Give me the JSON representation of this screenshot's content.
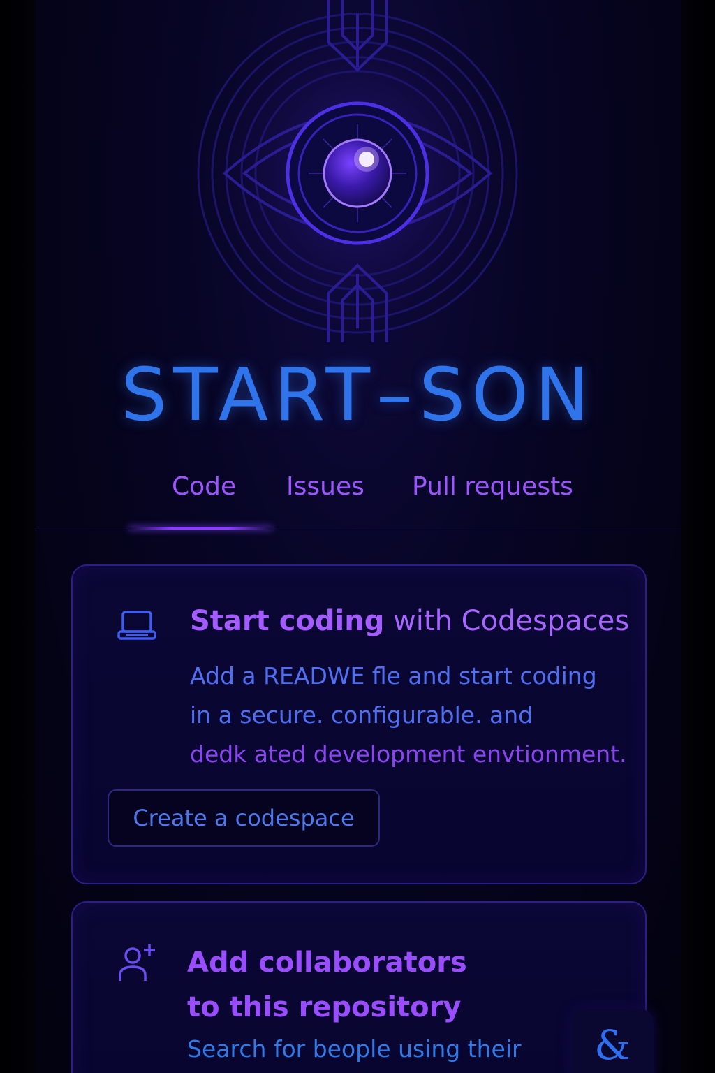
{
  "app": {
    "title": "START–SON"
  },
  "tabs": [
    {
      "label": "Code",
      "active": true
    },
    {
      "label": "Issues",
      "active": false
    },
    {
      "label": "Pull requests",
      "active": false
    }
  ],
  "codespaces_card": {
    "heading_strong": "Start coding",
    "heading_rest": "with Codespaces",
    "description_lines": [
      "Add a READWE fle and start coding",
      "in a secure. configurable. and",
      "dedk ated development envtionment."
    ],
    "button_label": "Create a codespace",
    "icon": "laptop-icon"
  },
  "collaborators_card": {
    "heading_lines": [
      "Add collaborators",
      "to this repository"
    ],
    "description": "Search for beople using their",
    "icon": "add-user-icon"
  },
  "fab": {
    "glyph": "&",
    "icon": "ampersand-icon"
  },
  "colors": {
    "title": "#2f74ea",
    "accent_purple": "#9d55ff",
    "card_border": "#2a1e8a",
    "background": "#040318"
  }
}
